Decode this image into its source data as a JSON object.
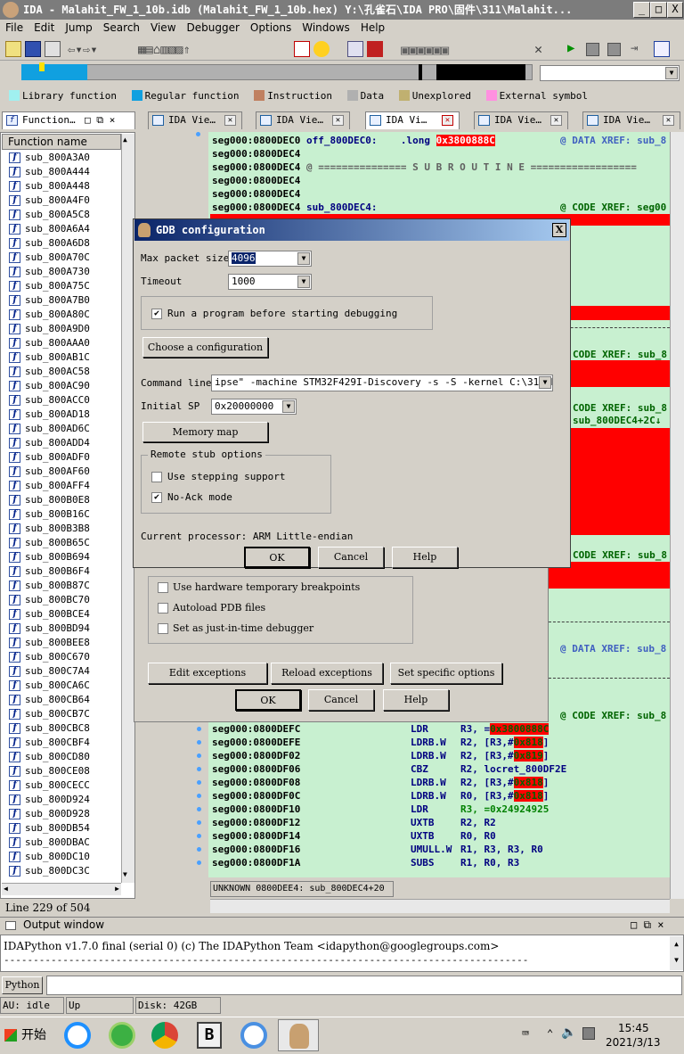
{
  "window": {
    "title": "IDA - Malahit_FW_1_10b.idb (Malahit_FW_1_10b.hex) Y:\\孔雀石\\IDA PRO\\固件\\311\\Malahit...",
    "min": "_",
    "max": "□",
    "close": "X"
  },
  "menu": [
    "File",
    "Edit",
    "Jump",
    "Search",
    "View",
    "Debugger",
    "Options",
    "Windows",
    "Help"
  ],
  "legend": [
    {
      "label": "Library function",
      "color": "#a0f0f0"
    },
    {
      "label": "Regular function",
      "color": "#10a0e0"
    },
    {
      "label": "Instruction",
      "color": "#c08060"
    },
    {
      "label": "Data",
      "color": "#b0b0b0"
    },
    {
      "label": "Unexplored",
      "color": "#c0b070"
    },
    {
      "label": "External symbol",
      "color": "#ff90e0"
    }
  ],
  "tabs": {
    "functions": "Function…",
    "views": [
      "IDA Vie…",
      "IDA Vie…",
      "IDA Vi…",
      "IDA Vie…",
      "IDA Vie…"
    ]
  },
  "functions": {
    "header": "Function name",
    "items": [
      "sub_800A3A0",
      "sub_800A444",
      "sub_800A448",
      "sub_800A4F0",
      "sub_800A5C8",
      "sub_800A6A4",
      "sub_800A6D8",
      "sub_800A70C",
      "sub_800A730",
      "sub_800A75C",
      "sub_800A7B0",
      "sub_800A80C",
      "sub_800A9D0",
      "sub_800AAA0",
      "sub_800AB1C",
      "sub_800AC58",
      "sub_800AC90",
      "sub_800ACC0",
      "sub_800AD18",
      "sub_800AD6C",
      "sub_800ADD4",
      "sub_800ADF0",
      "sub_800AF60",
      "sub_800AFF4",
      "sub_800B0E8",
      "sub_800B16C",
      "sub_800B3B8",
      "sub_800B65C",
      "sub_800B694",
      "sub_800B6F4",
      "sub_800B87C",
      "sub_800BC70",
      "sub_800BCE4",
      "sub_800BD94",
      "sub_800BEE8",
      "sub_800C670",
      "sub_800C7A4",
      "sub_800CA6C",
      "sub_800CB64",
      "sub_800CB7C",
      "sub_800CBC8",
      "sub_800CBF4",
      "sub_800CD80",
      "sub_800CE08",
      "sub_800CECC",
      "sub_800D924",
      "sub_800D928",
      "sub_800DB54",
      "sub_800DBAC",
      "sub_800DC10",
      "sub_800DC3C"
    ],
    "line": "Line 229 of 504"
  },
  "code_top": [
    {
      "addr": "seg000:0800DEC0",
      "rest": " off_800DEC0:    .long ",
      "hl": "0x3800888C",
      "cmt": "@ DATA XREF: sub_8"
    },
    {
      "addr": "seg000:0800DEC4",
      "rest": "",
      "hl": "",
      "cmt": ""
    },
    {
      "addr": "seg000:0800DEC4",
      "rest": " @ =============== S U B R O U T I N E ==================",
      "hl": "",
      "cmt": ""
    },
    {
      "addr": "seg000:0800DEC4",
      "rest": "",
      "hl": "",
      "cmt": ""
    },
    {
      "addr": "seg000:0800DEC4",
      "rest": "",
      "hl": "",
      "cmt": ""
    },
    {
      "addr": "seg000:0800DEC4",
      "rest": " sub_800DEC4:",
      "hl": "",
      "cmt": "@ CODE XREF: seg00"
    }
  ],
  "code_right": [
    {
      "text": "CODE XREF: sub_8"
    },
    {
      "text": "CODE XREF: sub_8"
    },
    {
      "text": "sub_800DEC4+2C↓"
    },
    {
      "text": "CODE XREF: sub_8"
    },
    {
      "text": "@ DATA XREF: sub_8"
    },
    {
      "text": "@ CODE XREF: sub_8"
    }
  ],
  "code_bottom": [
    {
      "addr": "seg000:0800DEFC",
      "op": "LDR",
      "args": "R3, =",
      "hl": "0x3800888C",
      "tail": ""
    },
    {
      "addr": "seg000:0800DEFE",
      "op": "LDRB.W",
      "args": "R2, [R3,#",
      "hl": "0x818",
      "tail": "]"
    },
    {
      "addr": "seg000:0800DF02",
      "op": "LDRB.W",
      "args": "R2, [R3,#",
      "hl": "0x819",
      "tail": "]"
    },
    {
      "addr": "seg000:0800DF06",
      "op": "CBZ",
      "args": "R2, locret_800DF2E",
      "hl": "",
      "tail": ""
    },
    {
      "addr": "seg000:0800DF08",
      "op": "LDRB.W",
      "args": "R2, [R3,#",
      "hl": "0x818",
      "tail": "]"
    },
    {
      "addr": "seg000:0800DF0C",
      "op": "LDRB.W",
      "args": "R0, [R3,#",
      "hl": "0x818",
      "tail": "]"
    },
    {
      "addr": "seg000:0800DF10",
      "op": "LDR",
      "args": "R3, =0x24924925",
      "hl": "",
      "tail": ""
    },
    {
      "addr": "seg000:0800DF12",
      "op": "UXTB",
      "args": "R2, R2",
      "hl": "",
      "tail": ""
    },
    {
      "addr": "seg000:0800DF14",
      "op": "UXTB",
      "args": "R0, R0",
      "hl": "",
      "tail": ""
    },
    {
      "addr": "seg000:0800DF16",
      "op": "UMULL.W",
      "args": "R1, R3, R3, R0",
      "hl": "",
      "tail": ""
    },
    {
      "addr": "seg000:0800DF1A",
      "op": "SUBS",
      "args": "R1, R0, R3",
      "hl": "",
      "tail": ""
    }
  ],
  "code_status": {
    "mode": "UNKNOWN",
    "loc": "0800DEE4: sub_800DEC4+20"
  },
  "gdb": {
    "title": "GDB configuration",
    "close": "X",
    "max_packet_label": "Max packet size",
    "max_packet": "4096",
    "timeout_label": "Timeout",
    "timeout": "1000",
    "run_program": "Run a program before starting debugging",
    "choose_config": "Choose a configuration",
    "cmdline_label": "Command line",
    "cmdline": "ipse\" -machine STM32F429I-Discovery -s -S -kernel C:\\311.bin",
    "sp_label": "Initial SP",
    "sp": "0x20000000",
    "memory_map": "Memory map",
    "remote_group": "Remote stub options",
    "stepping": "Use stepping support",
    "noack": "No-Ack mode",
    "processor": "Current processor: ARM Little-endian",
    "ok": "OK",
    "cancel": "Cancel",
    "help": "Help"
  },
  "debugopts": {
    "hw_bp": "Use hardware temporary breakpoints",
    "autoload": "Autoload PDB files",
    "jit": "Set as just-in-time debugger",
    "edit_exc": "Edit exceptions",
    "reload_exc": "Reload exceptions",
    "set_specific": "Set specific options",
    "ok": "OK",
    "cancel": "Cancel",
    "help": "Help"
  },
  "output": {
    "title": "Output window",
    "text": "IDAPython v1.7.0 final (serial 0) (c) The IDAPython Team <idapython@googlegroups.com>",
    "dashes": "-----------------------------------------------------------------------------------------",
    "python": "Python"
  },
  "statusbar": {
    "au": "AU:  idle",
    "dir": "Up",
    "disk": "Disk: 42GB"
  },
  "taskbar": {
    "start": "开始",
    "time": "15:45",
    "date": "2021/3/13"
  }
}
